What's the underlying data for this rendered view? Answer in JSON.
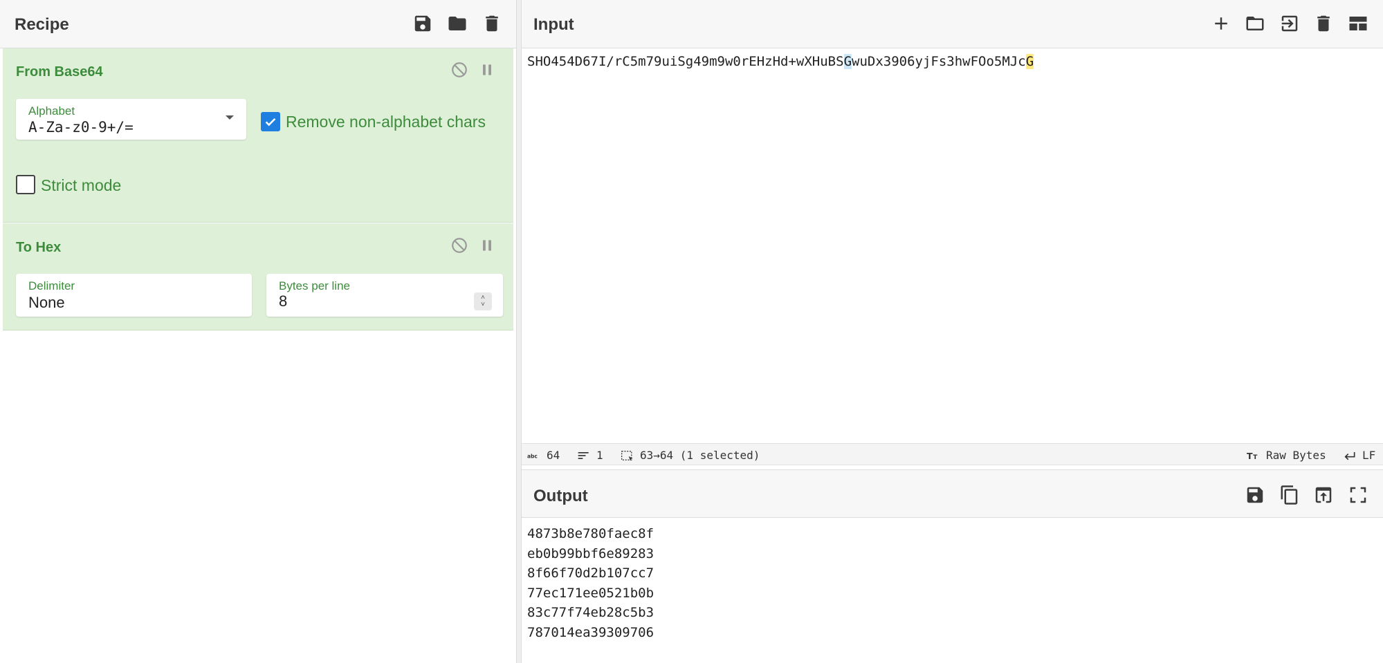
{
  "recipe": {
    "title": "Recipe",
    "buttons": [
      "save-icon",
      "folder-icon",
      "trash-icon"
    ],
    "operations": [
      {
        "name": "From Base64",
        "alphabet": {
          "label": "Alphabet",
          "value": "A-Za-z0-9+/="
        },
        "remove_non_alphabet": {
          "label": "Remove non-alphabet chars",
          "checked": true
        },
        "strict_mode": {
          "label": "Strict mode",
          "checked": false
        }
      },
      {
        "name": "To Hex",
        "delimiter": {
          "label": "Delimiter",
          "value": "None"
        },
        "bytes_per_line": {
          "label": "Bytes per line",
          "value": "8"
        }
      }
    ]
  },
  "input": {
    "title": "Input",
    "text_before": "SHO454D67I/rC5m79uiSg49m9w0rEHzHd+wXHuBS",
    "text_hl1": "G",
    "text_mid": "wuDx3906yjFs3hwFOo5MJc",
    "text_hl2": "G",
    "buttons": [
      "plus-icon",
      "folder-icon",
      "import-icon",
      "trash-icon",
      "layout-icon"
    ]
  },
  "status": {
    "chars": "64",
    "lines": "1",
    "selection": "63→64 (1 selected)",
    "encoding": "Raw Bytes",
    "eol": "LF"
  },
  "output": {
    "title": "Output",
    "lines": [
      "4873b8e780faec8f",
      "eb0b99bbf6e89283",
      "8f66f70d2b107cc7",
      "77ec171ee0521b0b",
      "83c77f74eb28c5b3",
      "787014ea39309706"
    ],
    "buttons": [
      "save-icon",
      "copy-icon",
      "replace-input-icon",
      "maximize-icon"
    ]
  },
  "colors": {
    "operation_bg": "#dff0d8",
    "operation_text": "#3c8c3c",
    "checkbox_on": "#1f7fe0",
    "highlight_selection": "#cde7f7",
    "highlight_match": "#ffe97a"
  }
}
